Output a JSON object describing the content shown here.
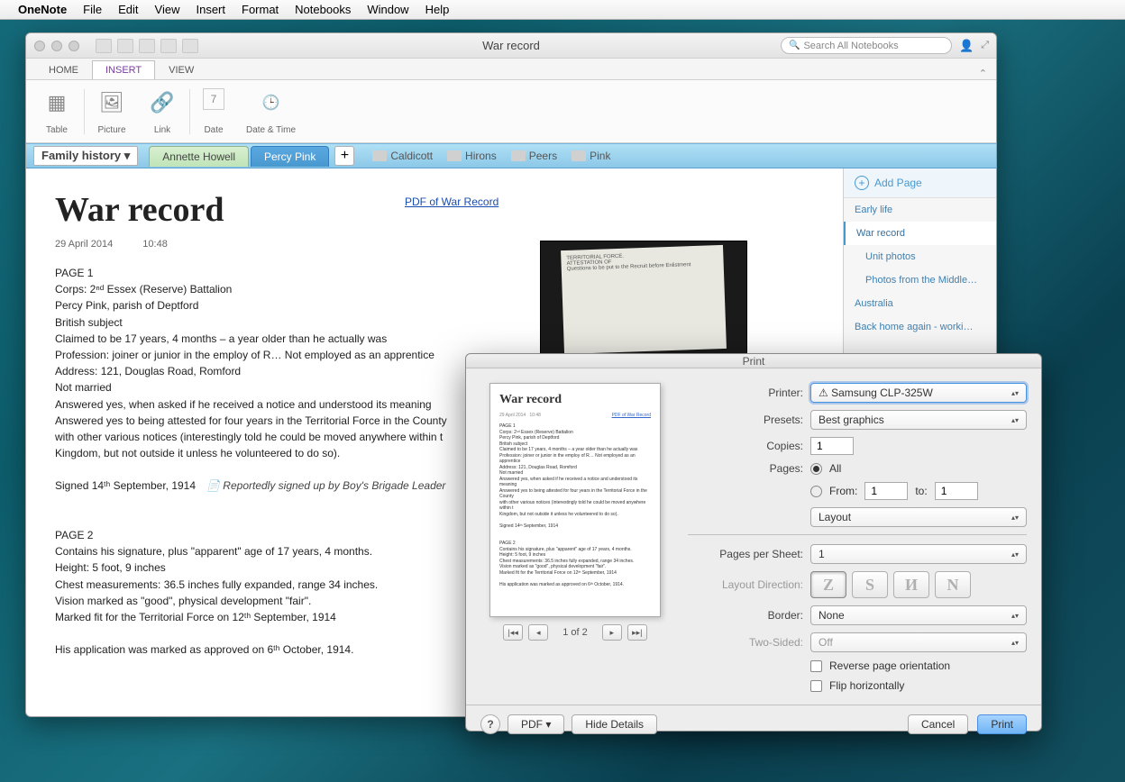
{
  "menubar": {
    "app": "OneNote",
    "items": [
      "File",
      "Edit",
      "View",
      "Insert",
      "Format",
      "Notebooks",
      "Window",
      "Help"
    ]
  },
  "window": {
    "title": "War record",
    "search_placeholder": "Search All Notebooks"
  },
  "ribbon": {
    "tabs": [
      "HOME",
      "INSERT",
      "VIEW"
    ],
    "groups": [
      {
        "label": "Table",
        "icon": "▦"
      },
      {
        "label": "Picture",
        "icon": "🖼"
      },
      {
        "label": "Link",
        "icon": "🔗"
      },
      {
        "label": "Date",
        "icon": "7"
      },
      {
        "label": "Date & Time",
        "icon": "🕒"
      }
    ]
  },
  "notebook": {
    "name": "Family history ▾",
    "sections": [
      {
        "label": "Annette Howell",
        "cls": "green"
      },
      {
        "label": "Percy Pink",
        "cls": "blue"
      }
    ],
    "quick": [
      "Caldicott",
      "Hirons",
      "Peers",
      "Pink"
    ]
  },
  "page": {
    "title": "War record",
    "date": "29 April 2014",
    "time": "10:48",
    "pdf_link": "PDF of War Record",
    "body": [
      "PAGE 1",
      "Corps: 2ⁿᵈ Essex (Reserve) Battalion",
      "Percy Pink, parish of Deptford",
      "British subject",
      "Claimed to be 17 years, 4 months – a year older than he actually was",
      "Profession: joiner or junior in the employ of R… Not employed as an apprentice",
      "Address: 121, Douglas Road, Romford",
      "Not married",
      "Answered yes, when asked if he received a notice and understood its meaning",
      "Answered yes to being attested for four years in the Territorial Force in the County",
      "with other various notices (interestingly told he could be moved anywhere within t",
      "Kingdom, but not outside it unless he volunteered to do so).",
      "",
      "Signed 14ᵗʰ September, 1914",
      "",
      "",
      "PAGE 2",
      "Contains his signature, plus \"apparent\" age of 17 years, 4 months.",
      "Height: 5 foot, 9 inches",
      "Chest measurements: 36.5 inches fully expanded, range 34 inches.",
      "Vision marked as \"good\", physical development \"fair\".",
      "Marked fit for the Territorial Force on 12ᵗʰ September, 1914",
      "",
      "His application was marked as approved on 6ᵗʰ October, 1914."
    ],
    "callout": "Reportedly signed up by Boy's Brigade Leader"
  },
  "sidebar": {
    "add": "Add Page",
    "pages": [
      {
        "label": "Early life"
      },
      {
        "label": "War record",
        "active": true
      },
      {
        "label": "Unit photos",
        "sub": true
      },
      {
        "label": "Photos from the Middle…",
        "sub": true
      },
      {
        "label": "Australia"
      },
      {
        "label": "Back home again - worki…"
      }
    ]
  },
  "print": {
    "title": "Print",
    "printer": "⚠ Samsung CLP-325W",
    "presets": "Best graphics",
    "copies": "1",
    "pages_all": "All",
    "pages_from_label": "From:",
    "from": "1",
    "to_label": "to:",
    "to": "1",
    "menu": "Layout",
    "pages_per_sheet": "1",
    "layout_direction": [
      "Z",
      "S",
      "И",
      "N"
    ],
    "border": "None",
    "two_sided": "Off",
    "reverse": "Reverse page orientation",
    "flip": "Flip horizontally",
    "nav": "1 of 2",
    "help": "?",
    "pdf": "PDF ▾",
    "hide": "Hide Details",
    "cancel": "Cancel",
    "print": "Print",
    "labels": {
      "printer": "Printer:",
      "presets": "Presets:",
      "copies": "Copies:",
      "pages": "Pages:",
      "pps": "Pages per Sheet:",
      "dir": "Layout Direction:",
      "border": "Border:",
      "two": "Two-Sided:"
    }
  }
}
